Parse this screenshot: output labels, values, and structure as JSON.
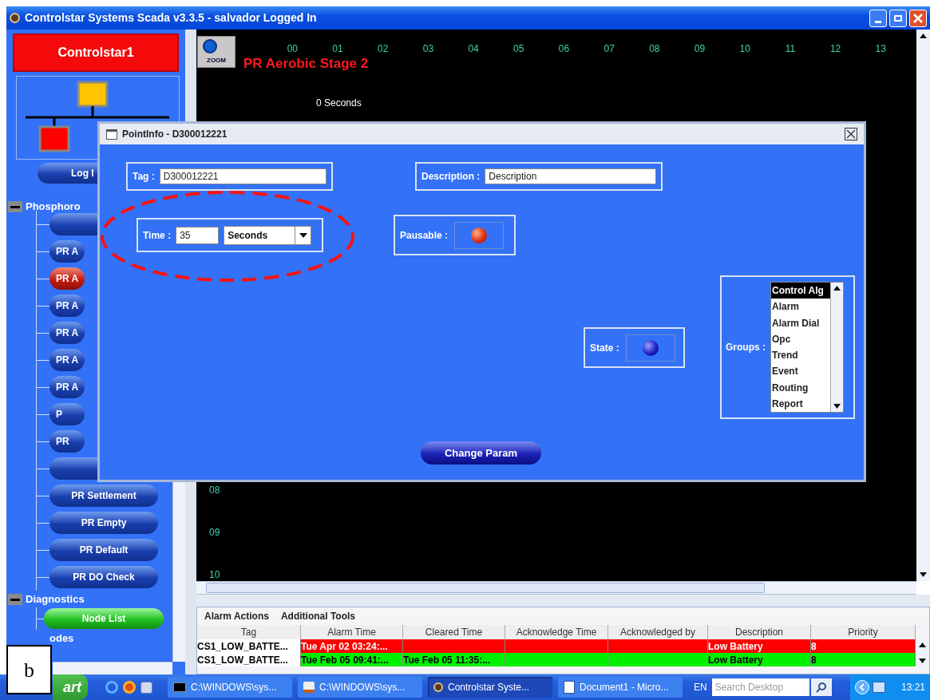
{
  "window": {
    "title": "Controlstar Systems Scada v3.3.5 - salvador Logged In"
  },
  "sidebar": {
    "node_title": "Controlstar1",
    "login_button": "Log I",
    "tree": [
      {
        "label": "Phosphoro",
        "kind": "steps",
        "expanded": true,
        "children": [
          {
            "selected": false,
            "truncated": false
          },
          {
            "label": "PR A",
            "selected": false,
            "truncated": true
          },
          {
            "label": "PR A",
            "selected": true,
            "truncated": true
          },
          {
            "label": "PR A",
            "selected": false,
            "truncated": true
          },
          {
            "label": "PR A",
            "selected": false,
            "truncated": true
          },
          {
            "label": "PR A",
            "selected": false,
            "truncated": true
          },
          {
            "label": "PR A",
            "selected": false,
            "truncated": true
          },
          {
            "label": "P",
            "selected": false,
            "truncated": true
          },
          {
            "label": "PR",
            "selected": false,
            "truncated": true
          },
          {
            "selected": false,
            "truncated": false
          },
          {
            "label": "PR Settlement",
            "selected": false,
            "truncated": false
          },
          {
            "label": "PR Empty",
            "selected": false,
            "truncated": false
          },
          {
            "label": "PR Default",
            "selected": false,
            "truncated": false
          },
          {
            "label": "PR DO Check",
            "selected": false,
            "truncated": false
          }
        ]
      },
      {
        "label": "Diagnostics",
        "kind": "tools",
        "expanded": true,
        "children": [
          {
            "label": "Node List"
          }
        ]
      },
      {
        "label": "odes"
      }
    ]
  },
  "canvas": {
    "zoom_button": "ZOOM",
    "title": "PR Aerobic Stage 2",
    "columns": [
      "00",
      "01",
      "02",
      "03",
      "04",
      "05",
      "06",
      "07",
      "08",
      "09",
      "10",
      "11",
      "12",
      "13"
    ],
    "timer": "0 Seconds",
    "rows": [
      "08",
      "09",
      "10"
    ]
  },
  "dialog": {
    "title": "PointInfo - D300012221",
    "tag": {
      "label": "Tag :",
      "value": "D300012221"
    },
    "description": {
      "label": "Description :",
      "value": "Description"
    },
    "time": {
      "label": "Time :",
      "value": "35",
      "unit": "Seconds"
    },
    "pausable": {
      "label": "Pausable :",
      "on": true
    },
    "state": {
      "label": "State :",
      "on": false
    },
    "groups": {
      "label": "Groups :",
      "items": [
        {
          "label": "Control Alg",
          "selected": true
        },
        {
          "label": "Alarm",
          "selected": false
        },
        {
          "label": "Alarm Dial",
          "selected": false
        },
        {
          "label": "Opc",
          "selected": false
        },
        {
          "label": "Trend",
          "selected": false
        },
        {
          "label": "Event",
          "selected": false
        },
        {
          "label": "Routing",
          "selected": false
        },
        {
          "label": "Report",
          "selected": false
        }
      ]
    },
    "button": "Change Param"
  },
  "alarms": {
    "menus": [
      "Alarm Actions",
      "Additional Tools"
    ],
    "columns": [
      "Tag",
      "Alarm Time",
      "Cleared Time",
      "Acknowledge Time",
      "Acknowledged by",
      "Description",
      "Priority"
    ],
    "rows": [
      {
        "cleared": false,
        "tag": "CS1_LOW_BATTE...",
        "alarm_time": "Tue Apr 02 03:24:...",
        "description": "Low Battery",
        "priority": "8"
      },
      {
        "cleared": true,
        "tag": "CS1_LOW_BATTE...",
        "alarm_time": "Tue Feb 05 09:41:...",
        "cleared_time": "Tue Feb 05 11:35:...",
        "description": "Low Battery",
        "priority": "8"
      }
    ]
  },
  "taskbar": {
    "start": "art",
    "tasks": [
      {
        "kind": "console",
        "label": "C:\\WINDOWS\\sys...",
        "selected": false
      },
      {
        "kind": "java",
        "label": "C:\\WINDOWS\\sys...",
        "selected": false
      },
      {
        "kind": "app",
        "label": "Controlstar Syste...",
        "selected": true
      },
      {
        "kind": "document",
        "label": "Document1 - Micro...",
        "selected": false
      }
    ],
    "language": "EN",
    "search_placeholder": "Search Desktop",
    "clock": "13:21"
  },
  "figure_label": "b"
}
